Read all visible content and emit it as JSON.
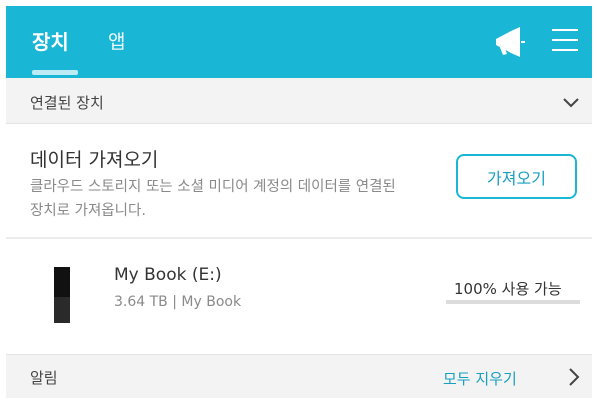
{
  "header": {
    "tabs": [
      {
        "label": "장치",
        "active": true
      },
      {
        "label": "앱",
        "active": false
      }
    ],
    "icons": [
      "megaphone-icon",
      "menu-icon"
    ],
    "color": "#1ab6d6"
  },
  "connected": {
    "label": "연결된 장치",
    "icon": "chevron-down-icon"
  },
  "import": {
    "title": "데이터 가져오기",
    "description": "클라우드 스토리지 또는 소셜 미디어 계정의 데이터를 연결된 장치로 가져옵니다.",
    "button_label": "가져오기"
  },
  "device": {
    "name": "My Book (E:)",
    "details": "3.64 TB | My Book",
    "usage": "100% 사용 가능",
    "icon": "drive-icon"
  },
  "notifications": {
    "label": "알림",
    "clear_label": "모두 지우기",
    "icon": "chevron-right-icon"
  }
}
